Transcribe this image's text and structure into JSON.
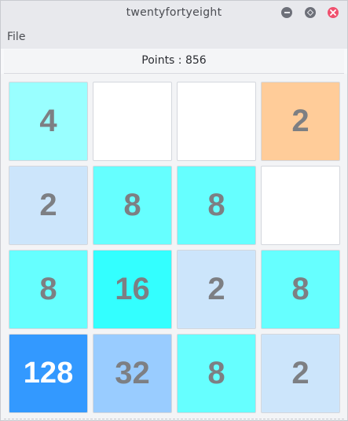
{
  "window": {
    "title": "twentyfortyeight"
  },
  "menu": {
    "file_label": "File"
  },
  "score": {
    "text": "Points : 856"
  },
  "grid": [
    [
      {
        "value": "4",
        "bg": "#99ffff",
        "fg": "#7d7f83"
      },
      {
        "value": "",
        "bg": "#ffffff",
        "fg": "#7d7f83"
      },
      {
        "value": "",
        "bg": "#ffffff",
        "fg": "#7d7f83"
      },
      {
        "value": "2",
        "bg": "#ffcc99",
        "fg": "#7d7f83"
      }
    ],
    [
      {
        "value": "2",
        "bg": "#cce5fb",
        "fg": "#7d7f83"
      },
      {
        "value": "8",
        "bg": "#66ffff",
        "fg": "#7d7f83"
      },
      {
        "value": "8",
        "bg": "#66ffff",
        "fg": "#7d7f83"
      },
      {
        "value": "",
        "bg": "#ffffff",
        "fg": "#7d7f83"
      }
    ],
    [
      {
        "value": "8",
        "bg": "#66ffff",
        "fg": "#7d7f83"
      },
      {
        "value": "16",
        "bg": "#33ffff",
        "fg": "#7d7f83"
      },
      {
        "value": "2",
        "bg": "#cce5fb",
        "fg": "#7d7f83"
      },
      {
        "value": "8",
        "bg": "#66ffff",
        "fg": "#7d7f83"
      }
    ],
    [
      {
        "value": "128",
        "bg": "#3399ff",
        "fg": "#ffffff"
      },
      {
        "value": "32",
        "bg": "#99ccff",
        "fg": "#7d7f83"
      },
      {
        "value": "8",
        "bg": "#66ffff",
        "fg": "#7d7f83"
      },
      {
        "value": "2",
        "bg": "#cce5fb",
        "fg": "#7d7f83"
      }
    ]
  ],
  "icons": {
    "minimize": "minimize-icon",
    "maximize": "maximize-icon",
    "close": "close-icon"
  }
}
